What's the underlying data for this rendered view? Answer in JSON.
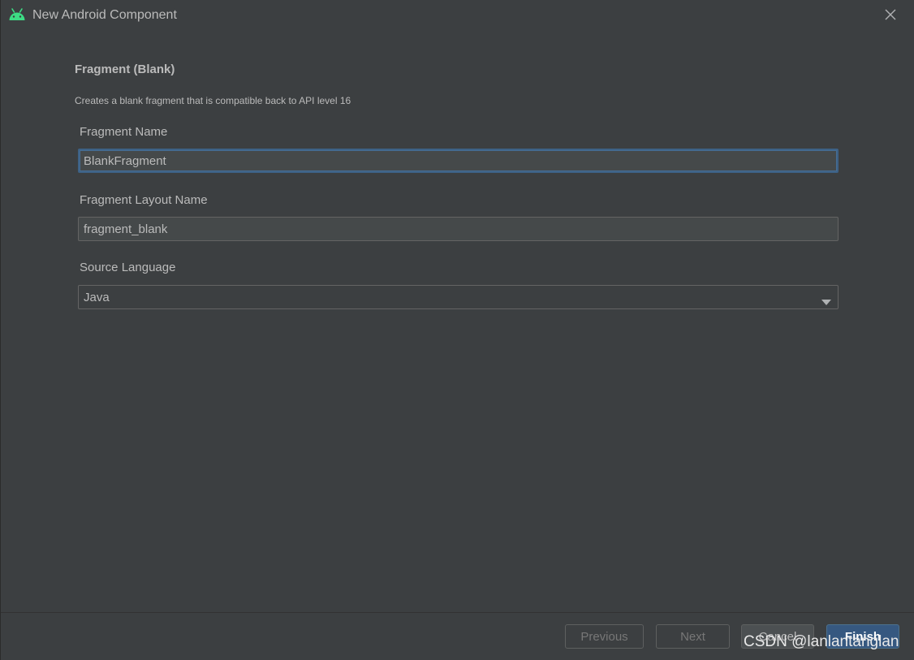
{
  "window": {
    "title": "New Android Component",
    "title_icon": "android-icon",
    "close_icon": "close-icon"
  },
  "form": {
    "heading": "Fragment (Blank)",
    "description": "Creates a blank fragment that is compatible back to API level 16",
    "fragment_name": {
      "label": "Fragment Name",
      "value": "BlankFragment"
    },
    "fragment_layout_name": {
      "label": "Fragment Layout Name",
      "value": "fragment_blank"
    },
    "source_language": {
      "label": "Source Language",
      "selected": "Java",
      "arrow_icon": "chevron-down-icon"
    }
  },
  "footer": {
    "previous_label": "Previous",
    "next_label": "Next",
    "cancel_label": "Cancel",
    "finish_label": "Finish"
  },
  "watermark": "CSDN @lanlantanglan",
  "colors": {
    "android_green": "#3ddc84",
    "background": "#3c3f41",
    "text": "#bbbbbb",
    "focus_border": "#3d6185",
    "primary_button": "#365880"
  }
}
